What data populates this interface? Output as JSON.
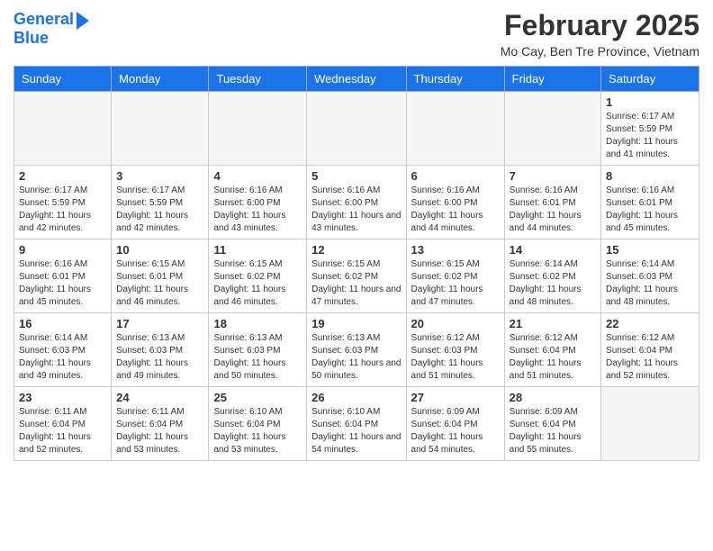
{
  "header": {
    "logo_line1": "General",
    "logo_line2": "Blue",
    "month_title": "February 2025",
    "location": "Mo Cay, Ben Tre Province, Vietnam"
  },
  "days_of_week": [
    "Sunday",
    "Monday",
    "Tuesday",
    "Wednesday",
    "Thursday",
    "Friday",
    "Saturday"
  ],
  "weeks": [
    [
      {
        "day": "",
        "content": ""
      },
      {
        "day": "",
        "content": ""
      },
      {
        "day": "",
        "content": ""
      },
      {
        "day": "",
        "content": ""
      },
      {
        "day": "",
        "content": ""
      },
      {
        "day": "",
        "content": ""
      },
      {
        "day": "1",
        "content": "Sunrise: 6:17 AM\nSunset: 5:59 PM\nDaylight: 11 hours and 41 minutes."
      }
    ],
    [
      {
        "day": "2",
        "content": "Sunrise: 6:17 AM\nSunset: 5:59 PM\nDaylight: 11 hours and 42 minutes."
      },
      {
        "day": "3",
        "content": "Sunrise: 6:17 AM\nSunset: 5:59 PM\nDaylight: 11 hours and 42 minutes."
      },
      {
        "day": "4",
        "content": "Sunrise: 6:16 AM\nSunset: 6:00 PM\nDaylight: 11 hours and 43 minutes."
      },
      {
        "day": "5",
        "content": "Sunrise: 6:16 AM\nSunset: 6:00 PM\nDaylight: 11 hours and 43 minutes."
      },
      {
        "day": "6",
        "content": "Sunrise: 6:16 AM\nSunset: 6:00 PM\nDaylight: 11 hours and 44 minutes."
      },
      {
        "day": "7",
        "content": "Sunrise: 6:16 AM\nSunset: 6:01 PM\nDaylight: 11 hours and 44 minutes."
      },
      {
        "day": "8",
        "content": "Sunrise: 6:16 AM\nSunset: 6:01 PM\nDaylight: 11 hours and 45 minutes."
      }
    ],
    [
      {
        "day": "9",
        "content": "Sunrise: 6:16 AM\nSunset: 6:01 PM\nDaylight: 11 hours and 45 minutes."
      },
      {
        "day": "10",
        "content": "Sunrise: 6:15 AM\nSunset: 6:01 PM\nDaylight: 11 hours and 46 minutes."
      },
      {
        "day": "11",
        "content": "Sunrise: 6:15 AM\nSunset: 6:02 PM\nDaylight: 11 hours and 46 minutes."
      },
      {
        "day": "12",
        "content": "Sunrise: 6:15 AM\nSunset: 6:02 PM\nDaylight: 11 hours and 47 minutes."
      },
      {
        "day": "13",
        "content": "Sunrise: 6:15 AM\nSunset: 6:02 PM\nDaylight: 11 hours and 47 minutes."
      },
      {
        "day": "14",
        "content": "Sunrise: 6:14 AM\nSunset: 6:02 PM\nDaylight: 11 hours and 48 minutes."
      },
      {
        "day": "15",
        "content": "Sunrise: 6:14 AM\nSunset: 6:03 PM\nDaylight: 11 hours and 48 minutes."
      }
    ],
    [
      {
        "day": "16",
        "content": "Sunrise: 6:14 AM\nSunset: 6:03 PM\nDaylight: 11 hours and 49 minutes."
      },
      {
        "day": "17",
        "content": "Sunrise: 6:13 AM\nSunset: 6:03 PM\nDaylight: 11 hours and 49 minutes."
      },
      {
        "day": "18",
        "content": "Sunrise: 6:13 AM\nSunset: 6:03 PM\nDaylight: 11 hours and 50 minutes."
      },
      {
        "day": "19",
        "content": "Sunrise: 6:13 AM\nSunset: 6:03 PM\nDaylight: 11 hours and 50 minutes."
      },
      {
        "day": "20",
        "content": "Sunrise: 6:12 AM\nSunset: 6:03 PM\nDaylight: 11 hours and 51 minutes."
      },
      {
        "day": "21",
        "content": "Sunrise: 6:12 AM\nSunset: 6:04 PM\nDaylight: 11 hours and 51 minutes."
      },
      {
        "day": "22",
        "content": "Sunrise: 6:12 AM\nSunset: 6:04 PM\nDaylight: 11 hours and 52 minutes."
      }
    ],
    [
      {
        "day": "23",
        "content": "Sunrise: 6:11 AM\nSunset: 6:04 PM\nDaylight: 11 hours and 52 minutes."
      },
      {
        "day": "24",
        "content": "Sunrise: 6:11 AM\nSunset: 6:04 PM\nDaylight: 11 hours and 53 minutes."
      },
      {
        "day": "25",
        "content": "Sunrise: 6:10 AM\nSunset: 6:04 PM\nDaylight: 11 hours and 53 minutes."
      },
      {
        "day": "26",
        "content": "Sunrise: 6:10 AM\nSunset: 6:04 PM\nDaylight: 11 hours and 54 minutes."
      },
      {
        "day": "27",
        "content": "Sunrise: 6:09 AM\nSunset: 6:04 PM\nDaylight: 11 hours and 54 minutes."
      },
      {
        "day": "28",
        "content": "Sunrise: 6:09 AM\nSunset: 6:04 PM\nDaylight: 11 hours and 55 minutes."
      },
      {
        "day": "",
        "content": ""
      }
    ]
  ]
}
